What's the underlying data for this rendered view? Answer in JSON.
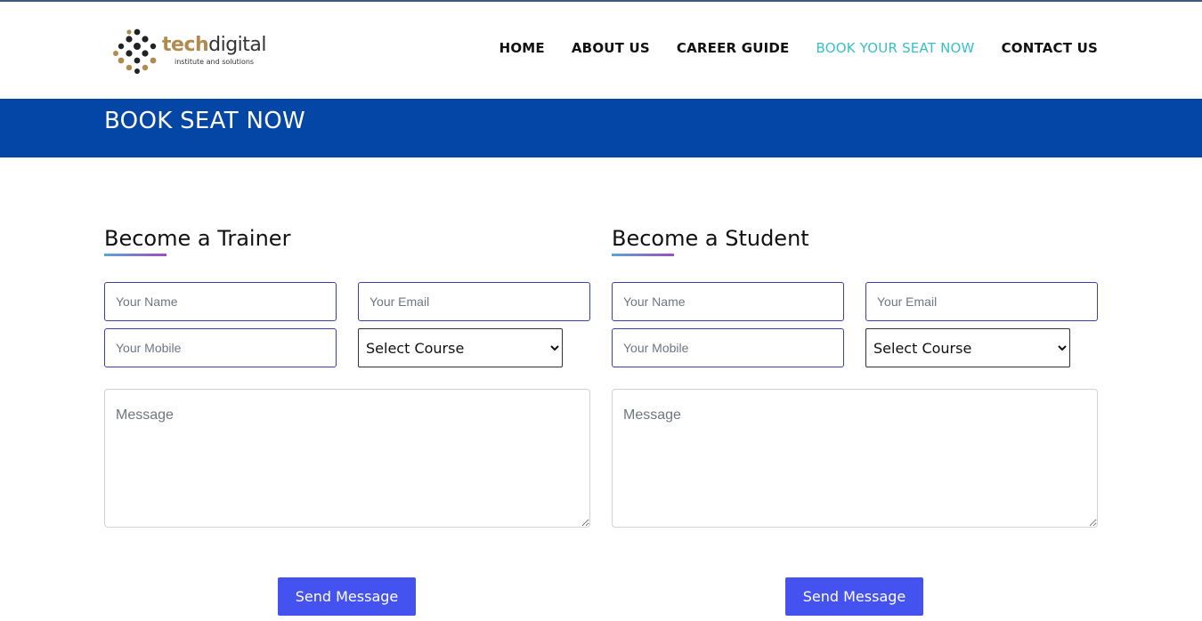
{
  "brand": {
    "name_part1": "tech",
    "name_part2": "digital",
    "tagline": "institute and solutions"
  },
  "nav": {
    "items": [
      {
        "label": "HOME",
        "active": false
      },
      {
        "label": "ABOUT US",
        "active": false
      },
      {
        "label": "CAREER GUIDE",
        "active": false
      },
      {
        "label": "BOOK YOUR SEAT NOW",
        "active": true
      },
      {
        "label": "CONTACT US",
        "active": false
      }
    ]
  },
  "banner": {
    "title": "BOOK SEAT NOW"
  },
  "trainer_form": {
    "heading": "Become a Trainer",
    "name_placeholder": "Your Name",
    "email_placeholder": "Your Email",
    "mobile_placeholder": "Your Mobile",
    "course_selected": "Select Course",
    "message_placeholder": "Message",
    "submit_label": "Send Message"
  },
  "student_form": {
    "heading": "Become a Student",
    "name_placeholder": "Your Name",
    "email_placeholder": "Your Email",
    "mobile_placeholder": "Your Mobile",
    "course_selected": "Select Course",
    "message_placeholder": "Message",
    "submit_label": "Send Message"
  },
  "colors": {
    "banner": "#0446a6",
    "nav_active": "#38c0c8",
    "button": "#4452f0",
    "input_border": "#3b3fae",
    "brand_gold": "#b08a4e"
  }
}
